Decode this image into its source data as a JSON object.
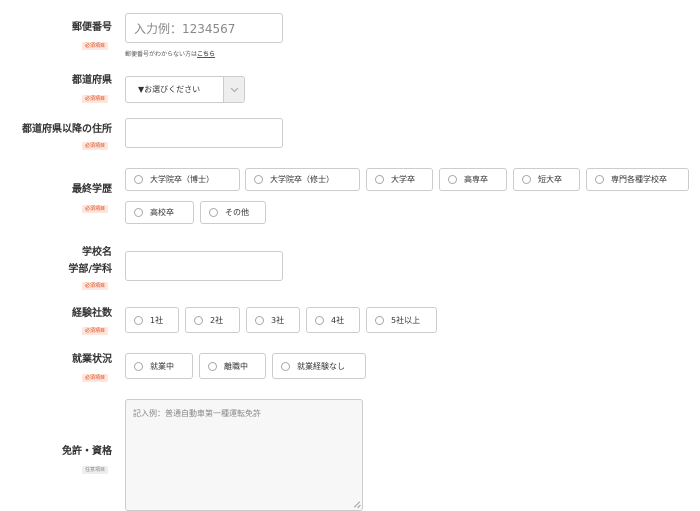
{
  "badges": {
    "required": "必須項目",
    "optional": "任意項目"
  },
  "postal": {
    "label": "郵便番号",
    "placeholder": "入力例：1234567",
    "note_prefix": "郵便番号がわからない方は",
    "note_link": "こちら"
  },
  "prefecture": {
    "label": "都道府県",
    "selected": "▼お選びください"
  },
  "address": {
    "label": "都道府県以降の住所",
    "value": ""
  },
  "education": {
    "label": "最終学歴",
    "options": [
      "大学院卒（博士）",
      "大学院卒（修士）",
      "大学卒",
      "高専卒",
      "短大卒",
      "専門各種学校卒",
      "高校卒",
      "その他"
    ]
  },
  "school": {
    "label_line1": "学校名",
    "label_line2": "学部/学科",
    "value": ""
  },
  "companies": {
    "label": "経験社数",
    "options": [
      "1社",
      "2社",
      "3社",
      "4社",
      "5社以上"
    ]
  },
  "employment": {
    "label": "就業状況",
    "options": [
      "就業中",
      "離職中",
      "就業経験なし"
    ]
  },
  "license": {
    "label": "免許・資格",
    "placeholder": "記入例：普通自動車第一種運転免許"
  },
  "icons": {
    "select_arrow": "chevron-down-icon",
    "resize_grip": "resize-grip-icon"
  }
}
